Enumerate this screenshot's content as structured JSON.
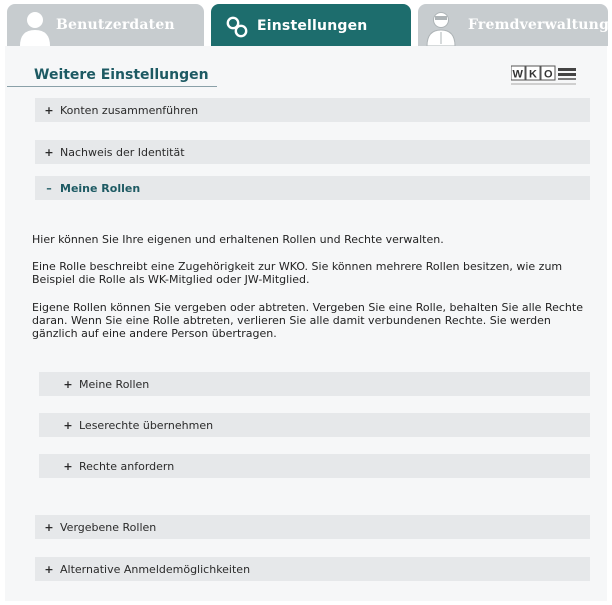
{
  "tabs": [
    {
      "label": "Benutzerdaten",
      "icon": "user-icon",
      "active": false
    },
    {
      "label": "Einstellungen",
      "icon": "settings-link-icon",
      "active": true
    },
    {
      "label": "Fremdverwaltung",
      "icon": "doctor-user-icon",
      "active": false
    }
  ],
  "main": {
    "title": "Weitere Einstellungen",
    "logo_text": "WKO",
    "sections": [
      {
        "label": "Konten zusammenführen",
        "sign": "+"
      },
      {
        "label": "Nachweis der Identität",
        "sign": "+"
      },
      {
        "label": "Meine Rollen",
        "sign": "–"
      }
    ],
    "roles_paragraphs": [
      "Hier können Sie Ihre eigenen und erhaltenen Rollen und Rechte verwalten.",
      "Eine Rolle beschreibt eine Zugehörigkeit zur WKO. Sie können mehrere Rollen besitzen, wie zum Beispiel die Rolle als WK-Mitglied oder JW-Mitglied.",
      "Eigene Rollen können Sie vergeben oder abtreten. Vergeben Sie eine Rolle, behalten Sie alle Rechte daran. Wenn Sie eine Rolle abtreten, verlieren Sie alle damit verbundenen Rechte. Sie werden gänzlich auf eine andere Person übertragen."
    ],
    "sub_sections": [
      {
        "label": "Meine Rollen",
        "sign": "+"
      },
      {
        "label": "Leserechte übernehmen",
        "sign": "+"
      },
      {
        "label": "Rechte anfordern",
        "sign": "+"
      }
    ],
    "bottom_sections": [
      {
        "label": "Vergebene Rollen",
        "sign": "+"
      },
      {
        "label": "Alternative Anmeldemöglichkeiten",
        "sign": "+"
      }
    ]
  },
  "colors": {
    "accent": "#1d6d6d",
    "tab_inactive": "#c7cccf",
    "row_bg": "#e6e8ea",
    "title": "#1d5a63"
  }
}
